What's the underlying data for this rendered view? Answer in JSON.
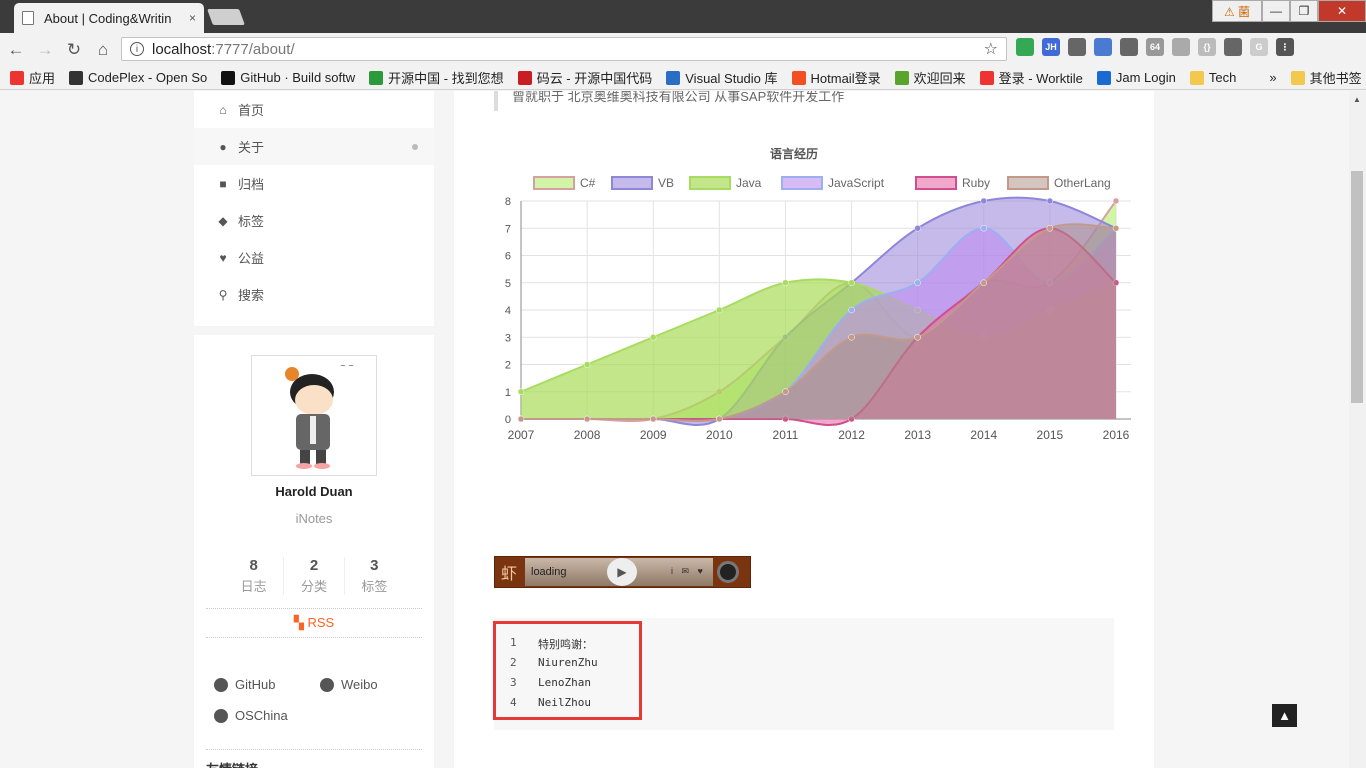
{
  "browser": {
    "tab_title": "About | Coding&Writin",
    "tab_close": "×",
    "warn_label": "⚠ 菌",
    "win_min": "—",
    "win_max": "❐",
    "win_close": "✕",
    "url_host": "localhost",
    "url_rest": ":7777/about/",
    "bookmarks": [
      {
        "label": "应用",
        "color": "#e33"
      },
      {
        "label": "CodePlex - Open So",
        "color": "#333"
      },
      {
        "label": "GitHub · Build softw",
        "color": "#111"
      },
      {
        "label": "开源中国 - 找到您想",
        "color": "#2a9a3b"
      },
      {
        "label": "码云 - 开源中国代码",
        "color": "#c71d23"
      },
      {
        "label": "Visual Studio 库",
        "color": "#2b6cc4"
      },
      {
        "label": "Hotmail登录",
        "color": "#f25022"
      },
      {
        "label": "欢迎回来",
        "color": "#5aa32c"
      },
      {
        "label": "登录 - Worktile",
        "color": "#e33"
      },
      {
        "label": "Jam Login",
        "color": "#1b6ad3"
      },
      {
        "label": "Tech",
        "color": "#f2c94c"
      },
      {
        "label": "»",
        "color": "transparent"
      },
      {
        "label": "其他书签",
        "color": "#f2c94c"
      }
    ],
    "extensions": [
      {
        "icon": "google-icon",
        "color": "#34a853",
        "text": ""
      },
      {
        "icon": "jh-icon",
        "color": "#3f6ad8",
        "text": "JH"
      },
      {
        "icon": "car-icon",
        "color": "#666",
        "text": ""
      },
      {
        "icon": "note-icon",
        "color": "#4a7bd0",
        "text": ""
      },
      {
        "icon": "gear-ext-icon",
        "color": "#666",
        "text": ""
      },
      {
        "icon": "64-icon",
        "color": "#999",
        "text": "64"
      },
      {
        "icon": "compass-icon",
        "color": "#aaa",
        "text": ""
      },
      {
        "icon": "bracket-icon",
        "color": "#bbb",
        "text": "{}"
      },
      {
        "icon": "sync-icon",
        "color": "#666",
        "text": ""
      },
      {
        "icon": "g-icon",
        "color": "#ccc",
        "text": "G"
      },
      {
        "icon": "menu-icon",
        "color": "#555",
        "text": "⋮"
      }
    ]
  },
  "menu": {
    "items": [
      {
        "label": "首页",
        "icon": "home-icon",
        "glyph": "⌂"
      },
      {
        "label": "关于",
        "icon": "user-icon",
        "glyph": "●"
      },
      {
        "label": "归档",
        "icon": "archive-icon",
        "glyph": "■"
      },
      {
        "label": "标签",
        "icon": "tags-icon",
        "glyph": "◆"
      },
      {
        "label": "公益",
        "icon": "heartbeat-icon",
        "glyph": "♥"
      },
      {
        "label": "搜索",
        "icon": "search-icon",
        "glyph": "⚲"
      }
    ]
  },
  "profile": {
    "name": "Harold Duan",
    "description": "iNotes",
    "stats": [
      {
        "count": "8",
        "label": "日志"
      },
      {
        "count": "2",
        "label": "分类"
      },
      {
        "count": "3",
        "label": "标签"
      }
    ],
    "rss": "RSS",
    "links": [
      {
        "label": "GitHub",
        "icon": "github-icon"
      },
      {
        "label": "Weibo",
        "icon": "weibo-icon"
      },
      {
        "label": "OSChina",
        "icon": "globe-icon"
      }
    ],
    "friend_links": "友情链接"
  },
  "content": {
    "quote": "曾就职于 北京奥维奥科技有限公司 从事SAP软件开发工作",
    "player_loading": "loading",
    "player_brand": "虾",
    "player_mini": "i ✉ ♥",
    "code_lines": [
      {
        "n": "1",
        "text": "特别鸣谢："
      },
      {
        "n": "2",
        "text": "NiurenZhu"
      },
      {
        "n": "3",
        "text": "LenoZhan"
      },
      {
        "n": "4",
        "text": "NeilZhou"
      }
    ]
  },
  "chart_data": {
    "type": "area",
    "title": "语言经历",
    "x": [
      "2007",
      "2008",
      "2009",
      "2010",
      "2011",
      "2012",
      "2013",
      "2014",
      "2015",
      "2016"
    ],
    "ylim": [
      0,
      8
    ],
    "yticks": [
      0,
      1,
      2,
      3,
      4,
      5,
      6,
      7,
      8
    ],
    "grid": true,
    "legend": "top",
    "series": [
      {
        "name": "C#",
        "fill": "rgba(190,240,130,0.7)",
        "stroke": "#d4a0a0",
        "values": [
          0,
          0,
          0,
          1,
          3,
          5,
          3,
          5,
          5,
          8
        ]
      },
      {
        "name": "VB",
        "fill": "rgba(160,140,220,0.6)",
        "stroke": "#8e86d8",
        "values": [
          0,
          0,
          0,
          0,
          3,
          5,
          7,
          8,
          8,
          7
        ]
      },
      {
        "name": "Java",
        "fill": "rgba(170,220,90,0.7)",
        "stroke": "#a8dc60",
        "values": [
          1,
          2,
          3,
          4,
          5,
          5,
          4,
          3,
          4,
          5
        ]
      },
      {
        "name": "JavaScript",
        "fill": "rgba(190,140,240,0.6)",
        "stroke": "#9ab0f0",
        "values": [
          0,
          0,
          0,
          0,
          1,
          4,
          5,
          7,
          5,
          7
        ]
      },
      {
        "name": "Ruby",
        "fill": "rgba(230,110,170,0.6)",
        "stroke": "#d04f8c",
        "values": [
          0,
          0,
          0,
          0,
          0,
          0,
          3,
          5,
          7,
          5
        ]
      },
      {
        "name": "OtherLang",
        "fill": "rgba(170,140,130,0.5)",
        "stroke": "#c39a8a",
        "values": [
          0,
          0,
          0,
          0,
          1,
          3,
          3,
          5,
          7,
          7
        ]
      }
    ]
  }
}
